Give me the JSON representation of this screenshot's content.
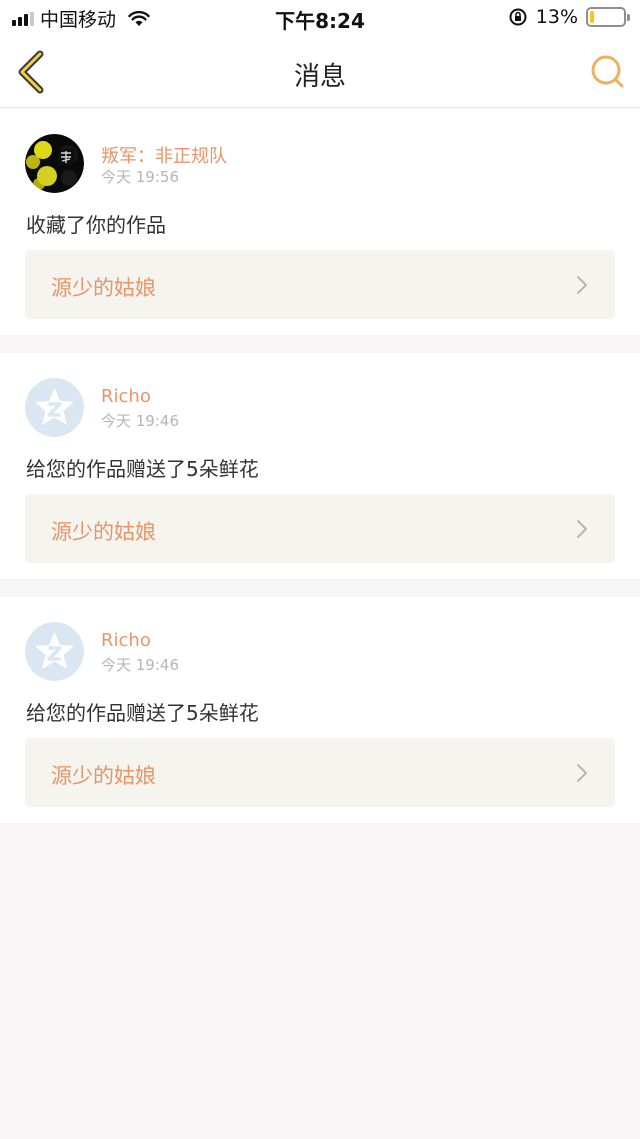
{
  "status_bar": {
    "carrier": "中国移动",
    "time": "下午8:24",
    "battery_percent": "13%",
    "battery_level": 0.13,
    "icons": [
      "signal-icon",
      "wifi-icon",
      "orientation-lock-icon",
      "battery-icon"
    ]
  },
  "nav": {
    "title": "消息",
    "back_icon": "chevron-left-icon",
    "search_icon": "search-icon",
    "accent_color": "#f0b060"
  },
  "messages": [
    {
      "user": "叛军：非正规队",
      "time": "今天 19:56",
      "text": "收藏了你的作品",
      "work": "源少的姑娘",
      "avatar": "custom-avatar"
    },
    {
      "user": "Richo",
      "time": "今天 19:46",
      "text": "给您的作品赠送了5朵鲜花",
      "work": "源少的姑娘",
      "avatar": "default-star-avatar"
    },
    {
      "user": "Richo",
      "time": "今天 19:46",
      "text": "给您的作品赠送了5朵鲜花",
      "work": "源少的姑娘",
      "avatar": "default-star-avatar"
    }
  ],
  "colors": {
    "username": "#e8956a",
    "work_title": "#e8956a",
    "work_bg": "#f5f4ef",
    "page_bg": "#f7f5f5"
  }
}
